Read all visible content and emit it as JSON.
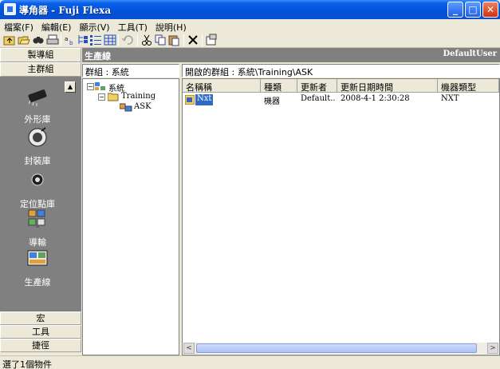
{
  "window": {
    "title": "導角器 - Fuji Flexa",
    "minimize_label": "_",
    "maximize_label": "□",
    "close_label": "✕"
  },
  "menu": {
    "items": [
      "檔案(F)",
      "編輯(E)",
      "顯示(V)",
      "工具(T)",
      "說明(H)"
    ]
  },
  "toolbar": {
    "icons": [
      "up-folder-icon",
      "open-icon",
      "find-icon",
      "print-icon",
      "sort-icon",
      "tree-view-icon",
      "list-view-icon",
      "details-view-icon",
      "undo-icon",
      "cut-icon",
      "copy-icon",
      "paste-icon",
      "delete-icon",
      "properties-icon"
    ]
  },
  "left_panel": {
    "header_top": "製導組",
    "header_main": "主群組",
    "items": [
      {
        "label": "外形庫",
        "icon": "shape-library-icon"
      },
      {
        "label": "封裝庫",
        "icon": "package-library-icon"
      },
      {
        "label": "定位點庫",
        "icon": "fiducial-library-icon"
      },
      {
        "label": "導輸",
        "icon": "transfer-icon"
      },
      {
        "label": "生產線",
        "icon": "production-line-icon"
      }
    ],
    "scroll_up_label": "▲",
    "footer": [
      "宏",
      "工具",
      "捷徑"
    ]
  },
  "main": {
    "header_title": "生產線",
    "header_user": "DefaultUser",
    "group_label": "群組 : 系統",
    "path_label": "開啟的群組 : 系統\\Training\\ASK"
  },
  "tree": {
    "root": "系統",
    "child": "Training",
    "grandchild": "ASK",
    "root_toggle": "−",
    "child_toggle": "−"
  },
  "list": {
    "columns": [
      "名稱稱",
      "種類",
      "更新者",
      "更新日期時間",
      "機器類型"
    ],
    "rows": [
      {
        "name": "Nxt",
        "type": "機器",
        "updater": "Default...",
        "datetime": "2008-4-1 2:30:28",
        "machine": "NXT"
      }
    ],
    "scroll_left": "<",
    "scroll_right": ">"
  },
  "status": {
    "text": "選了1個物件"
  }
}
